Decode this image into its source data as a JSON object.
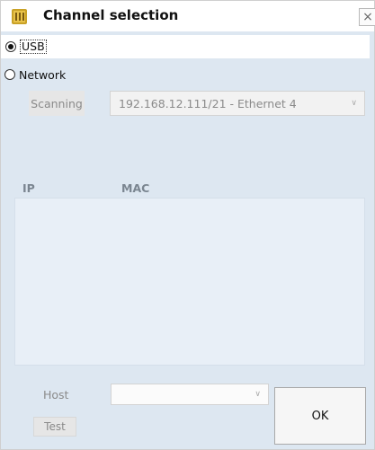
{
  "window": {
    "title": "Channel selection",
    "close_glyph": "×"
  },
  "channel": {
    "usb_label": "USB",
    "usb_selected": true,
    "network_label": "Network",
    "network_selected": false
  },
  "scanning": {
    "button_label": "Scanning",
    "interface_value": "192.168.12.111/21 - Ethernet 4"
  },
  "device_table": {
    "columns": [
      "IP",
      "MAC"
    ],
    "rows": []
  },
  "footer": {
    "host_label": "Host",
    "host_value": "",
    "test_label": "Test",
    "ok_label": "OK"
  },
  "icons": {
    "app": "app-icon",
    "dropdown": "chevron-down-icon"
  }
}
